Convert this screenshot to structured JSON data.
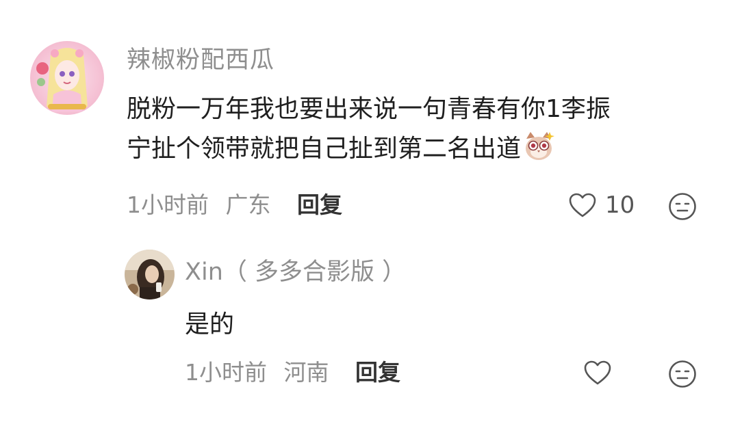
{
  "comments": [
    {
      "username": "辣椒粉配西瓜",
      "body_lines": [
        "脱粉一万年我也要出来说一句青春有你1李振",
        "宁扯个领带就把自己扯到第二名出道"
      ],
      "emoji": "owl-cat-sticker-icon",
      "time": "1小时前",
      "location": "广东",
      "reply_label": "回复",
      "likes": "10"
    }
  ],
  "replies": [
    {
      "username": "Xin（ 多多合影版 ）",
      "body": "是的",
      "time": "1小时前",
      "location": "河南",
      "reply_label": "回复"
    }
  ],
  "colors": {
    "username": "#8e8e8e",
    "text": "#1f1f1f",
    "meta": "#8e8e8e",
    "reply_button": "#333333",
    "icon": "#555555"
  }
}
